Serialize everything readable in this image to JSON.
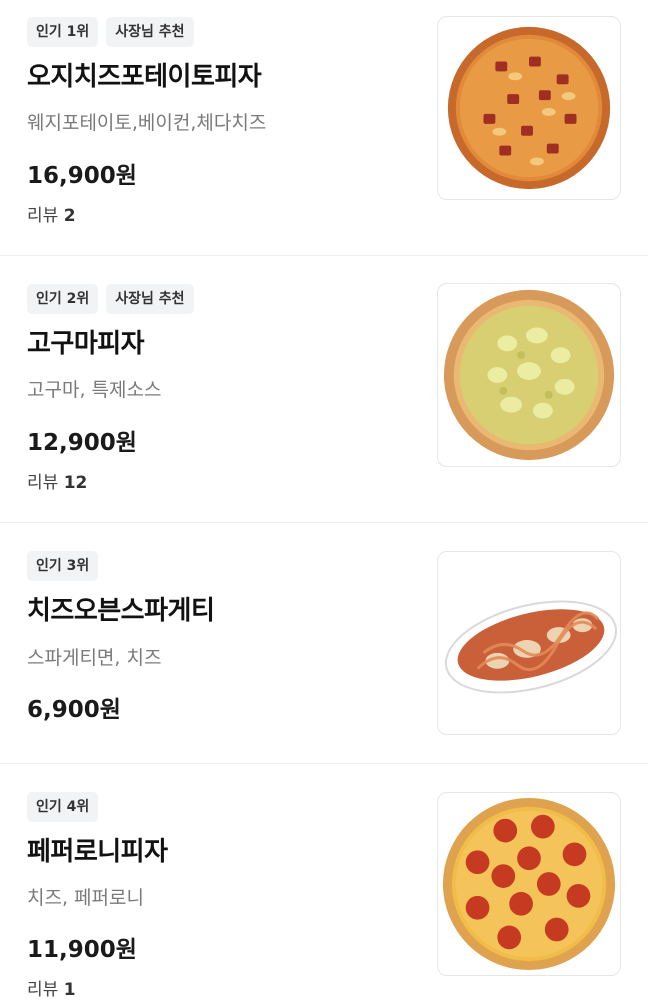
{
  "menu": {
    "items": [
      {
        "badges": [
          "인기 1위",
          "사장님 추천"
        ],
        "name": "오지치즈포테이토피자",
        "description": "웨지포테이토,베이컨,체다치즈",
        "price": "16,900원",
        "reviews_label": "리뷰",
        "reviews_count": "2",
        "image_icon": "potato-bacon-pizza-image"
      },
      {
        "badges": [
          "인기 2위",
          "사장님 추천"
        ],
        "name": "고구마피자",
        "description": "고구마, 특제소스",
        "price": "12,900원",
        "reviews_label": "리뷰",
        "reviews_count": "12",
        "image_icon": "sweet-potato-pizza-image"
      },
      {
        "badges": [
          "인기 3위"
        ],
        "name": "치즈오븐스파게티",
        "description": "스파게티면, 치즈",
        "price": "6,900원",
        "image_icon": "cheese-oven-spaghetti-image"
      },
      {
        "badges": [
          "인기 4위"
        ],
        "name": "페퍼로니피자",
        "description": "치즈, 페퍼로니",
        "price": "11,900원",
        "reviews_label": "리뷰",
        "reviews_count": "1",
        "image_icon": "pepperoni-pizza-image"
      }
    ]
  },
  "colors": {
    "badge_bg": "#f2f3f5",
    "name": "#121212",
    "description": "#7a7a7a",
    "divider": "#eeeeee"
  }
}
